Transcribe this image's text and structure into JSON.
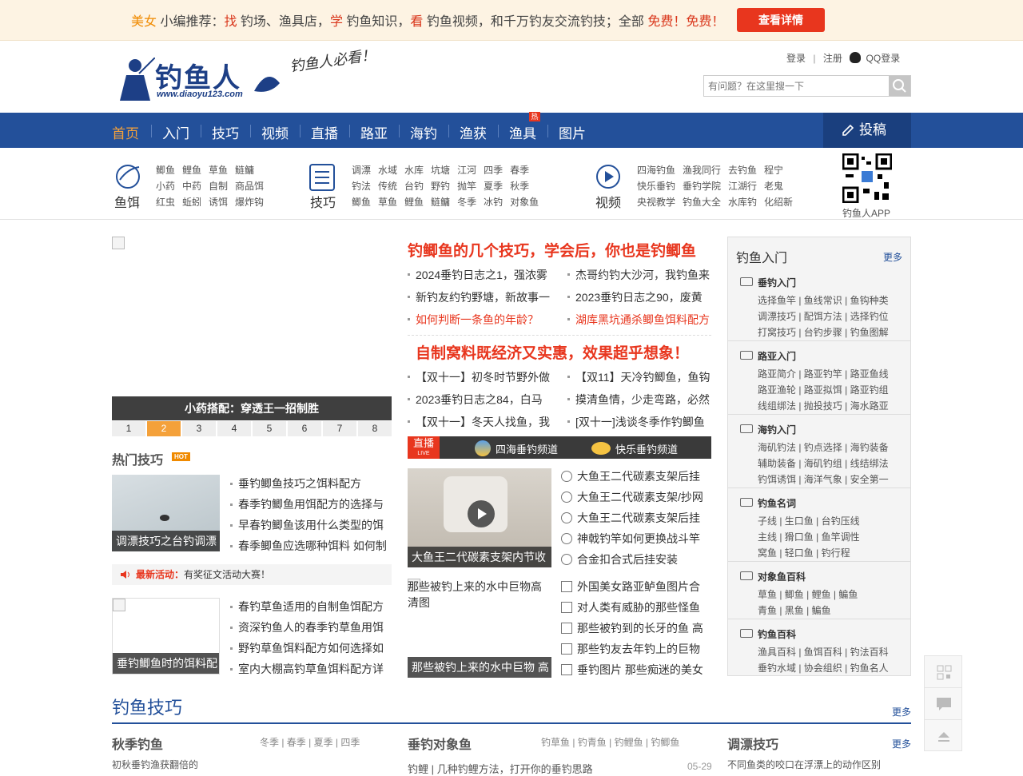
{
  "promo": {
    "parts": [
      {
        "t": "美女",
        "c": "o"
      },
      {
        "t": " 小编推荐：",
        "c": ""
      },
      {
        "t": "找",
        "c": "r"
      },
      {
        "t": " 钓场、渔具店，",
        "c": ""
      },
      {
        "t": "学",
        "c": "r"
      },
      {
        "t": " 钓鱼知识，",
        "c": ""
      },
      {
        "t": "看",
        "c": "r"
      },
      {
        "t": " 钓鱼视频，和千万钓友交流钓技；全部 ",
        "c": ""
      },
      {
        "t": "免费！免费！",
        "c": "r"
      }
    ],
    "button": "查看详情"
  },
  "header": {
    "logo_text": "钓鱼人",
    "logo_url": "www.diaoyu123.com",
    "slogan": "钓鱼人必看！",
    "login": "登录",
    "sep": "|",
    "register": "注册",
    "qq_login": "QQ登录",
    "search_placeholder": "有问题？在这里搜一下"
  },
  "nav": {
    "items": [
      "首页",
      "入门",
      "技巧",
      "视频",
      "直播",
      "路亚",
      "海钓",
      "渔获",
      "渔具",
      "图片"
    ],
    "hot_badge": "热",
    "post": "投稿"
  },
  "categories": {
    "bait": {
      "label": "鱼饵",
      "rows": [
        [
          "鲫鱼",
          "鲤鱼",
          "草鱼",
          "鲢鳙"
        ],
        [
          "小药",
          "中药",
          "自制",
          "商品饵"
        ],
        [
          "红虫",
          "蚯蚓",
          "诱饵",
          "爆炸钩"
        ]
      ]
    },
    "skill": {
      "label": "技巧",
      "rows": [
        [
          "调漂",
          "水域",
          "水库",
          "坑塘",
          "江河",
          "四季",
          "春季"
        ],
        [
          "钓法",
          "传统",
          "台钓",
          "野钓",
          "抛竿",
          "夏季",
          "秋季"
        ],
        [
          "鲫鱼",
          "草鱼",
          "鲤鱼",
          "鲢鳙",
          "冬季",
          "冰钓",
          "对象鱼"
        ]
      ]
    },
    "video": {
      "label": "视频",
      "rows": [
        [
          "四海钓鱼",
          "渔我同行",
          "去钓鱼",
          "程宁"
        ],
        [
          "快乐垂钓",
          "垂钓学院",
          "江湖行",
          "老鬼"
        ],
        [
          "央视教学",
          "钓鱼大全",
          "水库钓",
          "化绍新"
        ]
      ]
    },
    "app": "钓鱼人APP"
  },
  "slider": {
    "caption": "小药搭配：穿透王一招制胜",
    "pages": [
      "1",
      "2",
      "3",
      "4",
      "5",
      "6",
      "7",
      "8"
    ],
    "active": 1
  },
  "hot_skills": {
    "title": "热门技巧",
    "hot": "HOT",
    "thumb1": "调漂技巧之台钓调漂",
    "list1": [
      "垂钓鲫鱼技巧之饵料配方",
      "春季钓鲫鱼用饵配方的选择与",
      "早春钓鲫鱼该用什么类型的饵",
      "春季鲫鱼应选哪种饵料 如何制"
    ],
    "activity_label": "最新活动：",
    "activity_text": "有奖征文活动大赛！",
    "thumb2": "垂钓鲫鱼时的饵料配",
    "list2": [
      "春钓草鱼适用的自制鱼饵配方",
      "资深钓鱼人的春季钓草鱼用饵",
      "野钓草鱼饵料配方如何选择如",
      "室内大棚高钓草鱼饵料配方详"
    ]
  },
  "middle": {
    "headline1": "钓鲫鱼的几个技巧，学会后，你也是钓鲫鱼",
    "rows1": [
      [
        "2024垂钓日志之1，强浓雾",
        "杰哥约钓大沙河，我钓鱼来"
      ],
      [
        "新钓友约钓野塘，新故事一",
        "2023垂钓日志之90，废黄"
      ]
    ],
    "red_row": [
      "如何判断一条鱼的年龄？",
      "湖库黑坑通杀鲫鱼饵料配方"
    ],
    "headline2": "自制窝料既经济又实惠，效果超乎想象！",
    "rows2": [
      [
        "【双十一】初冬时节野外做",
        "【双11】天冷钓鲫鱼，鱼钩"
      ],
      [
        "2023垂钓日志之84，白马",
        "摸清鱼情，少走弯路，必然"
      ],
      [
        "【双十一】冬天人找鱼，我",
        "[双十一]浅谈冬季作钓鲫鱼"
      ]
    ],
    "live_label": "直播",
    "live_sub": "LIVE",
    "channel1": "四海垂钓频道",
    "channel2": "快乐垂钓频道",
    "video_thumb": "大鱼王二代碳素支架内节收",
    "video_list": [
      "大鱼王二代碳素支架后挂",
      "大鱼王二代碳素支架/抄网",
      "大鱼王二代碳素支架后挂",
      "神戟钓竿如何更换战斗竿",
      "合金扣合式后挂安装"
    ],
    "pic_alt": "那些被钓上来的水中巨物高清图",
    "pic_thumb": "那些被钓上来的水中巨物 高",
    "pic_list": [
      "外国美女路亚鲈鱼图片合",
      "对人类有威胁的那些怪鱼",
      "那些被钓到的长牙的鱼 高",
      "那些钓友去年钓上的巨物",
      "垂钓图片 那些痴迷的美女"
    ]
  },
  "sidebar": {
    "title": "钓鱼入门",
    "more": "更多",
    "blocks": [
      {
        "title": "垂钓入门",
        "rows": [
          "选择鱼竿 | 鱼线常识 | 鱼钩种类",
          "调漂技巧 | 配饵方法 | 选择钓位",
          "打窝技巧 | 台钓步骤 | 钓鱼图解"
        ]
      },
      {
        "title": "路亚入门",
        "rows": [
          "路亚简介 | 路亚钓竿 | 路亚鱼线",
          "路亚渔轮 | 路亚拟饵 | 路亚钓组",
          "线组绑法 | 抛投技巧 | 海水路亚"
        ]
      },
      {
        "title": "海钓入门",
        "rows": [
          "海矶钓法 | 钓点选择 | 海钓装备",
          "辅助装备 | 海矶钓组 | 线结绑法",
          "钓饵诱饵 | 海洋气象 | 安全第一"
        ]
      },
      {
        "title": "钓鱼名词",
        "rows": [
          "子线 | 生口鱼 | 台钓压线",
          "主线 | 猾口鱼 | 鱼竿调性",
          "窝鱼 | 轻口鱼 | 钓行程"
        ]
      },
      {
        "title": "对象鱼百科",
        "rows": [
          "草鱼 | 鲫鱼 | 鲤鱼 | 鳊鱼",
          "青鱼 | 黑鱼 | 鳊鱼"
        ]
      },
      {
        "title": "钓鱼百科",
        "rows": [
          "渔具百科 | 鱼饵百科 | 钓法百科",
          "垂钓水域 | 协会组织 | 钓鱼名人"
        ]
      }
    ]
  },
  "bottom": {
    "title": "钓鱼技巧",
    "more": "更多",
    "col1": {
      "title": "秋季钓鱼",
      "tags": "冬季 | 春季 | 夏季 | 四季",
      "img": "初秋垂钓渔获翻倍的"
    },
    "col2": {
      "title": "垂钓对象鱼",
      "tags": "钓草鱼 | 钓青鱼 | 钓鲤鱼 | 钓鲫鱼",
      "item": "钓鲤 | 几种钓鲤方法，打开你的垂钓思路",
      "date": "05-29"
    },
    "col3": {
      "title": "调漂技巧",
      "more": "更多",
      "img": "不同鱼类的咬口在浮漂上的动作区别"
    }
  }
}
